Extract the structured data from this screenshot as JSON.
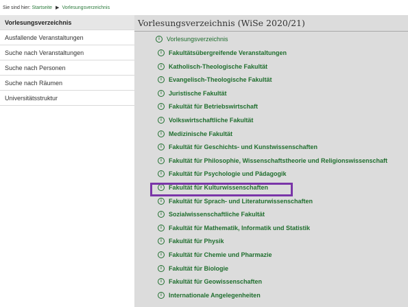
{
  "breadcrumb": {
    "prefix": "Sie sind hier:",
    "home": "Startseite",
    "current": "Vorlesungsverzeichnis"
  },
  "sidebar": {
    "items": [
      {
        "label": "Vorlesungsverzeichnis",
        "active": true
      },
      {
        "label": "Ausfallende Veranstaltungen",
        "active": false
      },
      {
        "label": "Suche nach Veranstaltungen",
        "active": false
      },
      {
        "label": "Suche nach Personen",
        "active": false
      },
      {
        "label": "Suche nach Räumen",
        "active": false
      },
      {
        "label": "Universitätsstruktur",
        "active": false
      }
    ]
  },
  "main": {
    "title": "Vorlesungsverzeichnis (WiSe 2020/21)",
    "root_label": "Vorlesungsverzeichnis",
    "faculties": [
      "Fakultätsübergreifende Veranstaltungen",
      "Katholisch-Theologische Fakultät",
      "Evangelisch-Theologische Fakultät",
      "Juristische Fakultät",
      "Fakultät für Betriebswirtschaft",
      "Volkswirtschaftliche Fakultät",
      "Medizinische Fakultät",
      "Fakultät für Geschichts- und Kunstwissenschaften",
      "Fakultät für Philosophie, Wissenschaftstheorie und Religionswissenschaft",
      "Fakultät für Psychologie und Pädagogik",
      "Fakultät für Kulturwissenschaften",
      "Fakultät für Sprach- und Literaturwissenschaften",
      "Sozialwissenschaftliche Fakultät",
      "Fakultät für Mathematik, Informatik und Statistik",
      "Fakultät für Physik",
      "Fakultät für Chemie und Pharmazie",
      "Fakultät für Biologie",
      "Fakultät für Geowissenschaften",
      "Internationale Angelegenheiten"
    ],
    "highlighted_faculty": "Fakultät für Kulturwissenschaften"
  },
  "colors": {
    "link_green": "#1f6e2e",
    "highlight": "#7a35a8",
    "panel_bg": "#dcdcdc"
  },
  "icons": {
    "tree_item": "info-icon",
    "breadcrumb_separator": "triangle-right-icon"
  }
}
